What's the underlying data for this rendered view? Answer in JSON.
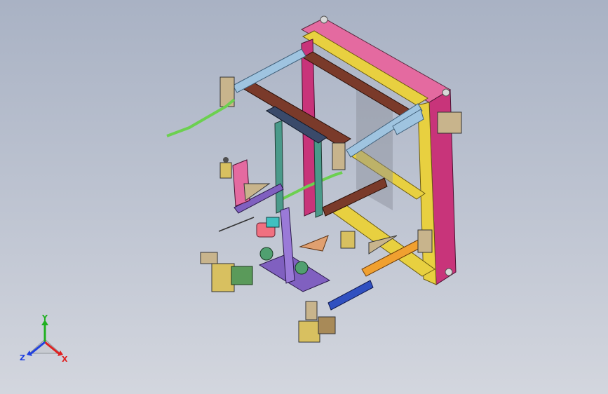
{
  "viewport": {
    "background_top": "#a9b2c4",
    "background_bottom": "#d3d6de"
  },
  "triad": {
    "x_label": "X",
    "y_label": "Y",
    "z_label": "Z",
    "x_color": "#e02020",
    "y_color": "#20b020",
    "z_color": "#2040e0"
  },
  "model": {
    "part_colors": {
      "top_plate": "#e46aa0",
      "yellow_frame": "#e8d040",
      "magenta_frame": "#c8347a",
      "brown_bar": "#7a3a2a",
      "light_blue_bar": "#9fc4e0",
      "green_rod": "#6cd050",
      "orange_bar": "#f0a030",
      "blue_bar": "#3050c0",
      "purple_frame": "#8060c0",
      "teal_column": "#4a9a8a",
      "tan_plate": "#c8b48c"
    }
  }
}
